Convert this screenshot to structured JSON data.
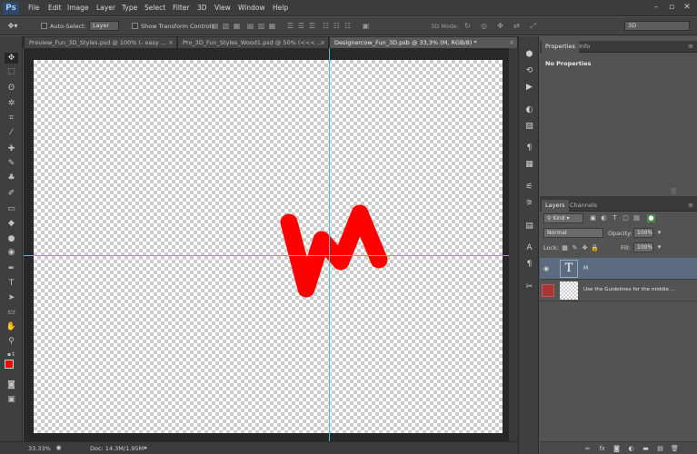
{
  "app": {
    "logo": "Ps"
  },
  "menu": [
    "File",
    "Edit",
    "Image",
    "Layer",
    "Type",
    "Select",
    "Filter",
    "3D",
    "View",
    "Window",
    "Help"
  ],
  "window_controls": {
    "minimize": "–",
    "maximize": "▫",
    "close": "✕"
  },
  "options_bar": {
    "auto_select_label": "Auto-Select:",
    "auto_select_target": "Layer",
    "show_transform_label": "Show Transform Controls",
    "mode_label": "3D Mode:",
    "workspace": "3D"
  },
  "tabs": [
    {
      "label": "Preview_Fun_3D_Styles.psd @ 100% (- easy ..."
    },
    {
      "label": "Pro_3D_Fun_Styles_Wood1.psd @ 50% (<<< ..."
    },
    {
      "label": "Designercow_Fun_3D.psb @ 33,3% (M, RGB/8) *"
    }
  ],
  "canvas": {
    "text": "M",
    "text_color": "#ff0000",
    "guide_color": "#39c8d6"
  },
  "colors": {
    "foreground": "#ff0000",
    "background": "#000000"
  },
  "status": {
    "zoom": "33.33%",
    "doc": "Doc: 14.3M/1.95M"
  },
  "properties_panel": {
    "tabs": [
      "Properties",
      "Info"
    ],
    "content": "No Properties"
  },
  "layers_panel": {
    "tabs": [
      "Layers",
      "Channels"
    ],
    "filter_kind": "Kind",
    "blend_mode": "Normal",
    "opacity_label": "Opacity:",
    "opacity_value": "100%",
    "lock_label": "Lock:",
    "fill_label": "Fill:",
    "fill_value": "100%",
    "layers": [
      {
        "name": "M",
        "type_glyph": "T",
        "selected": true
      },
      {
        "name": "Use the Guidelines for the middle ...",
        "selected": false
      }
    ],
    "footer_icons": [
      "link-icon",
      "fx-icon",
      "mask-icon",
      "adjustment-icon",
      "folder-icon",
      "new-layer-icon",
      "trash-icon"
    ]
  }
}
